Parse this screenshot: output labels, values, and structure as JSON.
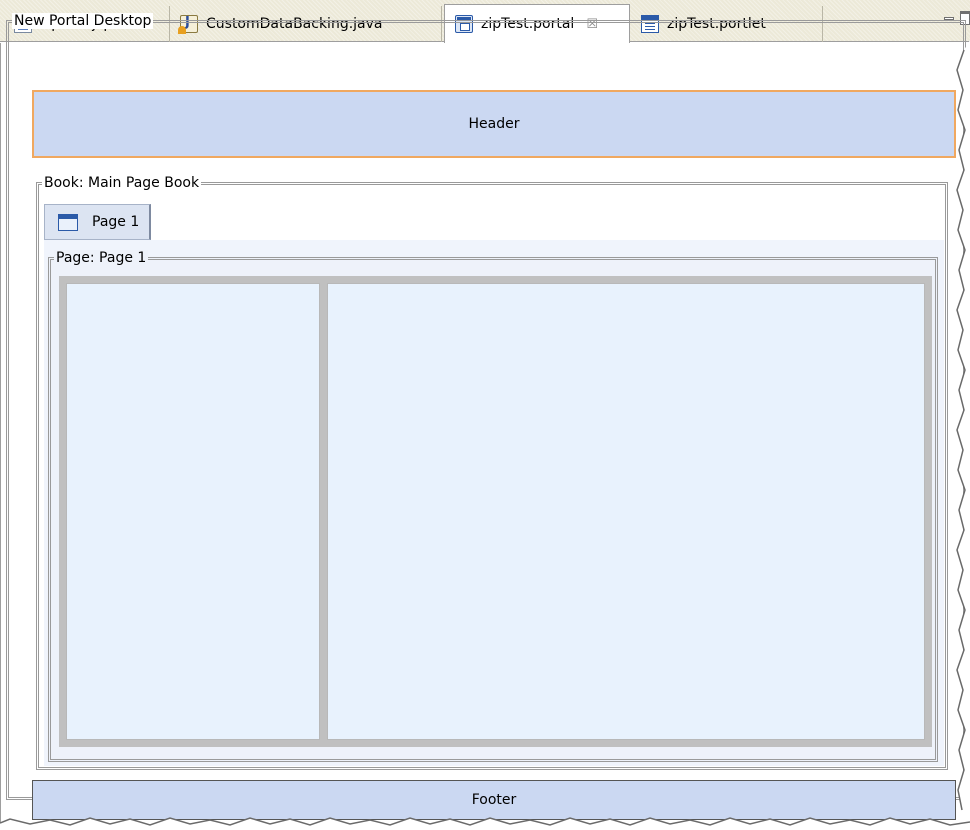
{
  "tabs": [
    {
      "label": "zipTest.jsp",
      "icon": "jsp-file-icon"
    },
    {
      "label": "CustomDataBacking.java",
      "icon": "java-file-icon"
    },
    {
      "label": "zipTest.portal",
      "icon": "portal-file-icon",
      "active": true
    },
    {
      "label": "zipTest.portlet",
      "icon": "portlet-file-icon"
    }
  ],
  "tab_close_glyph": "☒",
  "editor": {
    "desktop_legend": "New Portal Desktop",
    "header_label": "Header",
    "book_legend": "Book: Main Page Book",
    "book_tab_label": "Page 1",
    "page_legend": "Page: Page 1",
    "footer_label": "Footer"
  },
  "colors": {
    "band_fill": "#cbd8f2",
    "header_border": "#f0a860",
    "column_fill": "#e8f2fd"
  }
}
